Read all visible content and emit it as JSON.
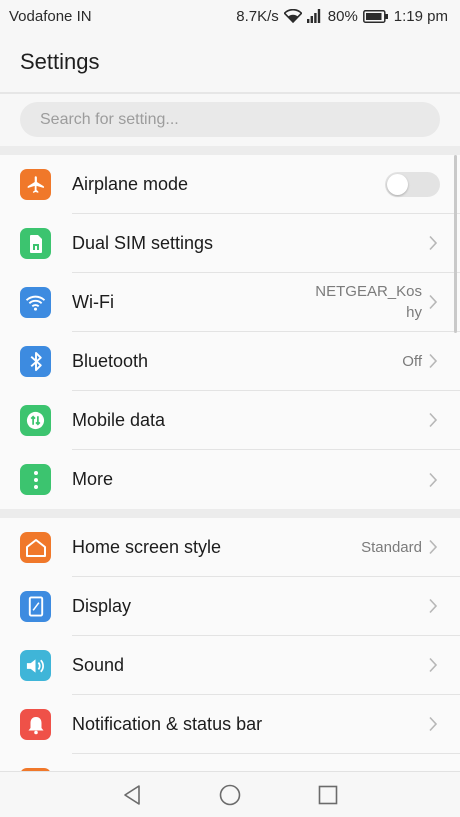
{
  "status_bar": {
    "carrier": "Vodafone IN",
    "net_speed": "8.7K/s",
    "battery": "80%",
    "time": "1:19 pm"
  },
  "header": {
    "title": "Settings"
  },
  "search": {
    "placeholder": "Search for setting..."
  },
  "sections": [
    {
      "items": [
        {
          "label": "Airplane mode",
          "icon": "airplane-icon",
          "color": "#f0782a",
          "control": "toggle",
          "toggle_on": false
        },
        {
          "label": "Dual SIM settings",
          "icon": "sim-card-icon",
          "color": "#3cc46f",
          "control": "chevron"
        },
        {
          "label": "Wi-Fi",
          "icon": "wifi-icon",
          "color": "#3d8be0",
          "value_line1": "NETGEAR_Kos",
          "value_line2": "hy",
          "control": "chevron"
        },
        {
          "label": "Bluetooth",
          "icon": "bluetooth-icon",
          "color": "#3d8be0",
          "value": "Off",
          "control": "chevron"
        },
        {
          "label": "Mobile data",
          "icon": "mobile-data-icon",
          "color": "#3cc46f",
          "control": "chevron"
        },
        {
          "label": "More",
          "icon": "more-icon",
          "color": "#3cc46f",
          "control": "chevron"
        }
      ]
    },
    {
      "items": [
        {
          "label": "Home screen style",
          "icon": "home-icon",
          "color": "#f0782a",
          "value": "Standard",
          "control": "chevron"
        },
        {
          "label": "Display",
          "icon": "display-icon",
          "color": "#3d8be0",
          "control": "chevron"
        },
        {
          "label": "Sound",
          "icon": "speaker-icon",
          "color": "#3fb5d8",
          "control": "chevron"
        },
        {
          "label": "Notification & status bar",
          "icon": "bell-icon",
          "color": "#ef5148",
          "control": "chevron"
        }
      ]
    }
  ],
  "nav": {
    "back": "back-icon",
    "home": "home-circle-icon",
    "recents": "recents-icon"
  }
}
